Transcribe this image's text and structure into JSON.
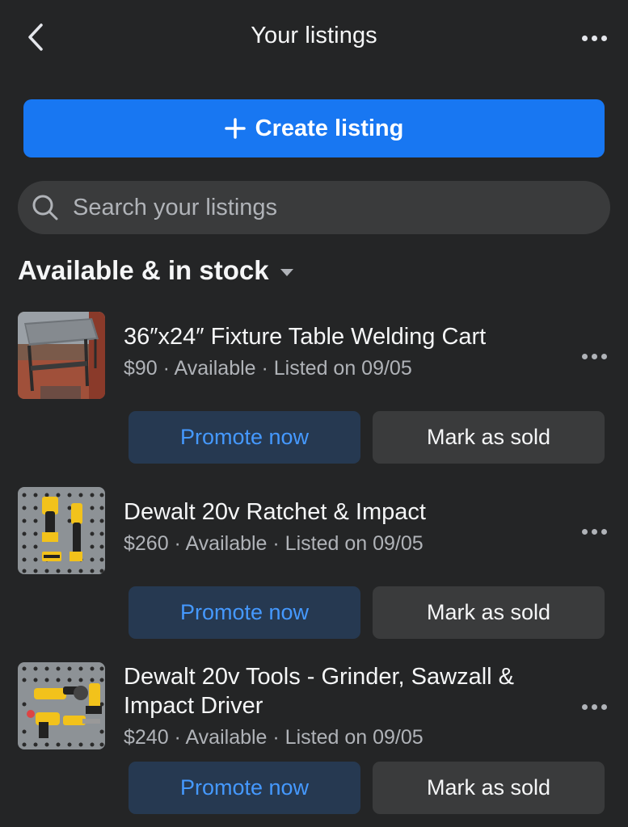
{
  "header": {
    "title": "Your listings"
  },
  "create_button": {
    "label": "Create listing"
  },
  "search": {
    "placeholder": "Search your listings",
    "value": ""
  },
  "section": {
    "title": "Available & in stock"
  },
  "listings": [
    {
      "title": "36″x24″ Fixture Table Welding Cart",
      "meta": "$90 · Available · Listed on 09/05",
      "promote_label": "Promote now",
      "sold_label": "Mark as sold"
    },
    {
      "title": "Dewalt 20v Ratchet & Impact",
      "meta": "$260 · Available · Listed on 09/05",
      "promote_label": "Promote now",
      "sold_label": "Mark as sold"
    },
    {
      "title": "Dewalt 20v Tools - Grinder, Sawzall & Impact Driver",
      "meta": "$240 · Available · Listed on 09/05",
      "promote_label": "Promote now",
      "sold_label": "Mark as sold"
    }
  ],
  "colors": {
    "background": "#242526",
    "accent": "#1877f2",
    "promote_bg": "#263951",
    "promote_text": "#4599ff",
    "secondary_button": "#3a3b3c"
  },
  "icons": [
    "chevron-left-icon",
    "more-dots-icon",
    "plus-icon",
    "search-icon",
    "caret-down-icon"
  ]
}
